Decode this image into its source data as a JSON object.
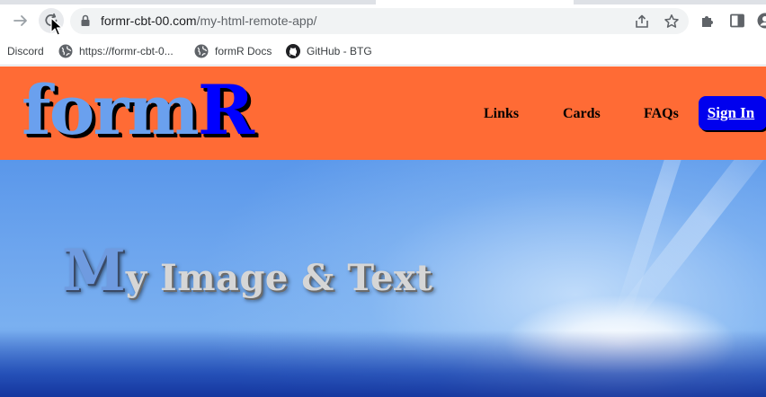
{
  "browser": {
    "url_host": "formr-cbt-00.com",
    "url_path": "/my-html-remote-app/",
    "bookmarks": [
      {
        "label": "Discord",
        "icon": "none"
      },
      {
        "label": "https://formr-cbt-0...",
        "icon": "globe-icon"
      },
      {
        "label": "formR Docs",
        "icon": "globe-icon"
      },
      {
        "label": "GitHub - BTG",
        "icon": "github-icon"
      }
    ]
  },
  "site": {
    "logo_part1": "form",
    "logo_part2": "R",
    "nav": [
      "Links",
      "Cards",
      "FAQs"
    ],
    "signin_label": "Sign In"
  },
  "hero": {
    "title_initial": "M",
    "title_rest": "y Image & Text"
  },
  "colors": {
    "header_bg": "#ff6b35",
    "logo_light": "#6aa0ee",
    "logo_accent": "#0000ff",
    "signin_bg": "#0000ee"
  }
}
